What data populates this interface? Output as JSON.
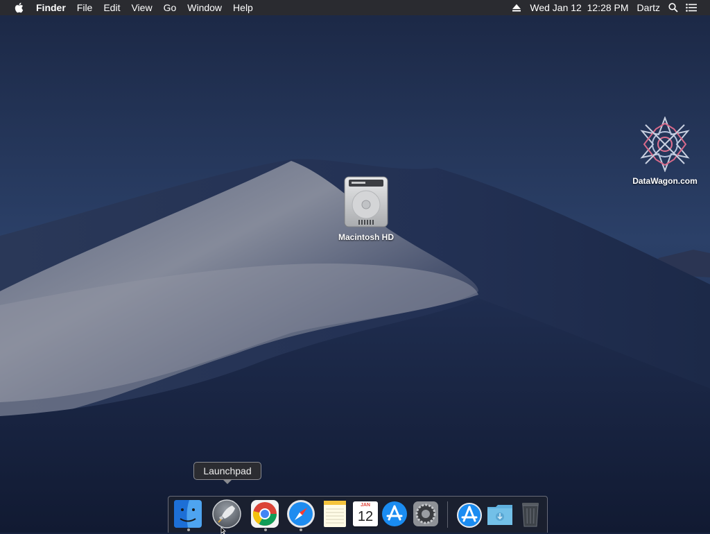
{
  "menubar": {
    "app_name": "Finder",
    "menus": [
      "File",
      "Edit",
      "View",
      "Go",
      "Window",
      "Help"
    ],
    "datetime": "Wed Jan 12  12:28 PM",
    "user": "Dartz"
  },
  "desktop": {
    "icons": [
      {
        "label": "Macintosh HD",
        "icon": "hard-drive-icon"
      },
      {
        "label": "DataWagon.com",
        "icon": "datawagon-logo-icon"
      }
    ]
  },
  "tooltip": {
    "text": "Launchpad"
  },
  "dock": {
    "items": [
      {
        "name": "Finder",
        "icon": "finder-icon",
        "running": true
      },
      {
        "name": "Launchpad",
        "icon": "launchpad-icon",
        "running": false
      },
      {
        "name": "Google Chrome",
        "icon": "chrome-icon",
        "running": true
      },
      {
        "name": "Safari",
        "icon": "safari-icon",
        "running": true
      },
      {
        "name": "Notes",
        "icon": "notes-icon",
        "running": false
      },
      {
        "name": "Calendar",
        "icon": "calendar-icon",
        "running": false,
        "month": "JAN",
        "day": "12"
      },
      {
        "name": "App Store",
        "icon": "app-store-icon",
        "running": false
      },
      {
        "name": "System Preferences",
        "icon": "system-preferences-icon",
        "running": false
      },
      {
        "name": "Applications",
        "icon": "applications-stack-icon",
        "running": false
      },
      {
        "name": "Downloads",
        "icon": "downloads-folder-icon",
        "running": false
      },
      {
        "name": "Trash",
        "icon": "trash-icon",
        "running": false
      }
    ]
  },
  "colors": {
    "menubar": "#2a2b30",
    "wallpaper_sky": "#22355a",
    "dune": "#5c6a86"
  }
}
